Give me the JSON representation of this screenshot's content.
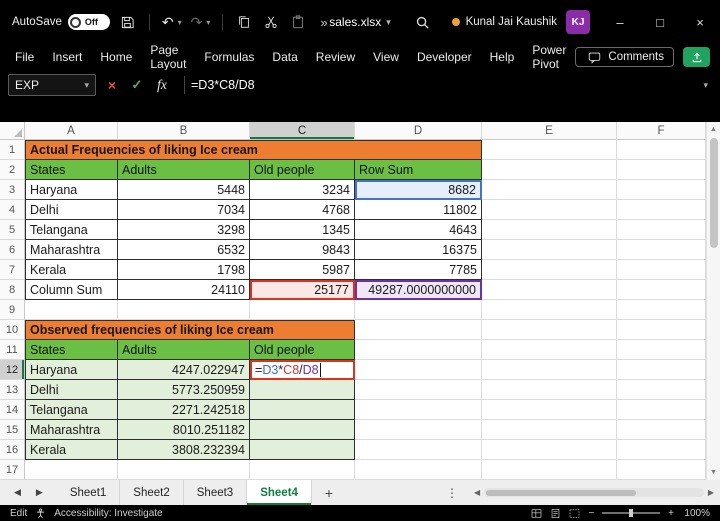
{
  "window": {
    "autosave_label": "AutoSave",
    "autosave_state": "Off",
    "filename": "sales.xlsx",
    "user_name": "Kunal Jai Kaushik",
    "user_initials": "KJ"
  },
  "ribbon": {
    "tabs": [
      "File",
      "Insert",
      "Home",
      "Page Layout",
      "Formulas",
      "Data",
      "Review",
      "View",
      "Developer",
      "Help",
      "Power Pivot"
    ],
    "comments_label": "Comments"
  },
  "formula_bar": {
    "name_box_value": "EXP",
    "formula": "=D3*C8/D8"
  },
  "sheet": {
    "columns": [
      "A",
      "B",
      "C",
      "D",
      "E",
      "F"
    ],
    "row_count": 17,
    "active_cell": "C12",
    "selected_column": "C",
    "selected_row": 12,
    "formula_tokens": [
      {
        "text": "=",
        "color": "#1f1f1f"
      },
      {
        "text": "D3",
        "color": "#3F6AC4"
      },
      {
        "text": "*",
        "color": "#1f1f1f"
      },
      {
        "text": "C8",
        "color": "#D13438"
      },
      {
        "text": "/",
        "color": "#1f1f1f"
      },
      {
        "text": "D8",
        "color": "#7030A0"
      }
    ],
    "rows": [
      [
        {
          "c": "abcd",
          "v": "Actual Frequencies of liking Ice cream",
          "s": "o",
          "x": "bt bl"
        }
      ],
      [
        {
          "c": "a",
          "v": "States",
          "s": "g",
          "x": "bl"
        },
        {
          "c": "b",
          "v": "Adults",
          "s": "g"
        },
        {
          "c": "c",
          "v": "Old people",
          "s": "g"
        },
        {
          "c": "d",
          "v": "Row Sum",
          "s": "g"
        }
      ],
      [
        {
          "c": "a",
          "v": "Haryana",
          "s": "t",
          "x": "bl"
        },
        {
          "c": "b",
          "v": "5448",
          "s": "n"
        },
        {
          "c": "c",
          "v": "3234",
          "s": "n"
        },
        {
          "c": "d",
          "v": "8682",
          "s": "refblue"
        }
      ],
      [
        {
          "c": "a",
          "v": "Delhi",
          "s": "t",
          "x": "bl"
        },
        {
          "c": "b",
          "v": "7034",
          "s": "n"
        },
        {
          "c": "c",
          "v": "4768",
          "s": "n"
        },
        {
          "c": "d",
          "v": "11802",
          "s": "n"
        }
      ],
      [
        {
          "c": "a",
          "v": "Telangana",
          "s": "t",
          "x": "bl"
        },
        {
          "c": "b",
          "v": "3298",
          "s": "n"
        },
        {
          "c": "c",
          "v": "1345",
          "s": "n"
        },
        {
          "c": "d",
          "v": "4643",
          "s": "n"
        }
      ],
      [
        {
          "c": "a",
          "v": "Maharashtra",
          "s": "t",
          "x": "bl"
        },
        {
          "c": "b",
          "v": "6532",
          "s": "n"
        },
        {
          "c": "c",
          "v": "9843",
          "s": "n"
        },
        {
          "c": "d",
          "v": "16375",
          "s": "n"
        }
      ],
      [
        {
          "c": "a",
          "v": "Kerala",
          "s": "t",
          "x": "bl"
        },
        {
          "c": "b",
          "v": "1798",
          "s": "n"
        },
        {
          "c": "c",
          "v": "5987",
          "s": "n"
        },
        {
          "c": "d",
          "v": "7785",
          "s": "n"
        }
      ],
      [
        {
          "c": "a",
          "v": "Column Sum",
          "s": "t",
          "x": "bl"
        },
        {
          "c": "b",
          "v": "24110",
          "s": "n"
        },
        {
          "c": "c",
          "v": "25177",
          "s": "refred"
        },
        {
          "c": "d",
          "v": "49287.0000000000",
          "s": "refpurple"
        }
      ],
      [],
      [
        {
          "c": "abc",
          "v": "Observed frequencies of liking Ice cream",
          "s": "o",
          "x": "bt bl"
        }
      ],
      [
        {
          "c": "a",
          "v": "States",
          "s": "g",
          "x": "bl"
        },
        {
          "c": "b",
          "v": "Adults",
          "s": "g"
        },
        {
          "c": "c",
          "v": "Old people",
          "s": "g"
        }
      ],
      [
        {
          "c": "a",
          "v": "Haryana",
          "s": "lgt",
          "x": "bl"
        },
        {
          "c": "b",
          "v": "4247.022947",
          "s": "lgn"
        },
        {
          "c": "c",
          "s": "edit"
        }
      ],
      [
        {
          "c": "a",
          "v": "Delhi",
          "s": "lgt",
          "x": "bl"
        },
        {
          "c": "b",
          "v": "5773.250959",
          "s": "lgn"
        },
        {
          "c": "c",
          "v": "",
          "s": "lg"
        }
      ],
      [
        {
          "c": "a",
          "v": "Telangana",
          "s": "lgt",
          "x": "bl"
        },
        {
          "c": "b",
          "v": "2271.242518",
          "s": "lgn"
        },
        {
          "c": "c",
          "v": "",
          "s": "lg"
        }
      ],
      [
        {
          "c": "a",
          "v": "Maharashtra",
          "s": "lgt",
          "x": "bl"
        },
        {
          "c": "b",
          "v": "8010.251182",
          "s": "lgn"
        },
        {
          "c": "c",
          "v": "",
          "s": "lg"
        }
      ],
      [
        {
          "c": "a",
          "v": "Kerala",
          "s": "lgt",
          "x": "bl"
        },
        {
          "c": "b",
          "v": "3808.232394",
          "s": "lgn"
        },
        {
          "c": "c",
          "v": "",
          "s": "lg"
        }
      ],
      []
    ]
  },
  "tabs_bar": {
    "sheets": [
      "Sheet1",
      "Sheet2",
      "Sheet3",
      "Sheet4"
    ],
    "active_sheet": "Sheet4"
  },
  "status_bar": {
    "mode": "Edit",
    "accessibility": "Accessibility: Investigate",
    "zoom": "100%"
  },
  "icons": {
    "dropdown": "▾",
    "more": "»",
    "undo": "↶",
    "redo": "↷",
    "cancel": "×",
    "enter": "✓",
    "fx": "fx",
    "nav_left": "◀",
    "nav_right": "▶",
    "add_sheet": "+",
    "overflow": "⋮",
    "minimize": "–",
    "maximize": "□",
    "close": "×",
    "scroll_up": "▲",
    "scroll_down": "▼",
    "zoom_out": "−",
    "zoom_in": "+"
  },
  "colors": {
    "table_title_orange": "#ED7D31",
    "table_header_green": "#6CBF45",
    "table_body_light_green": "#E2EFDA",
    "active_sheet_green": "#107C41",
    "ref_blue": "#4472C4",
    "ref_red": "#E0301E",
    "ref_purple": "#7030A0",
    "avatar_purple": "#8A2BA8",
    "presence_orange": "#F0A030"
  }
}
